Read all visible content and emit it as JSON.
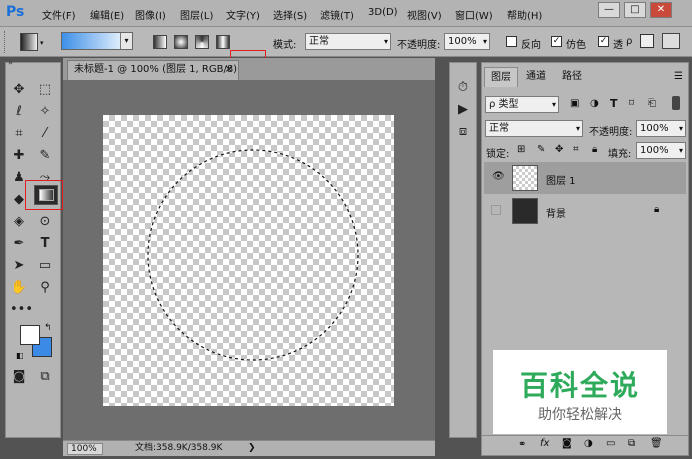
{
  "app": {
    "logo": "Ps"
  },
  "menu": [
    "文件(F)",
    "编辑(E)",
    "图像(I)",
    "图层(L)",
    "文字(Y)",
    "选择(S)",
    "滤镜(T)",
    "3D(D)",
    "视图(V)",
    "窗口(W)",
    "帮助(H)"
  ],
  "window_controls": {
    "minimize": "—",
    "maximize": "□",
    "close": "✕"
  },
  "options": {
    "mode_label": "模式:",
    "mode_value": "正常",
    "opacity_label": "不透明度:",
    "opacity_value": "100%",
    "reverse_label": "反向",
    "dither_label": "仿色",
    "transparency_label": "透"
  },
  "document": {
    "tab_title": "未标题-1 @ 100% (图层 1, RGB/8) *",
    "close": "×",
    "zoom": "100%",
    "doc_info": "文档:358.9K/358.9K",
    "status_arrow": "❯"
  },
  "layers_panel": {
    "tabs": [
      "图层",
      "通道",
      "路径"
    ],
    "filter_label": "ρ 类型",
    "blend_mode": "正常",
    "opacity_label": "不透明度:",
    "opacity_value": "100%",
    "lock_label": "锁定:",
    "fill_label": "填充:",
    "fill_value": "100%",
    "layers": [
      {
        "name": "图层 1",
        "visible": true,
        "active": true
      },
      {
        "name": "背景",
        "visible": false,
        "active": false
      }
    ]
  },
  "watermark": {
    "title": "百科全说",
    "subtitle": "助你轻松解决"
  }
}
